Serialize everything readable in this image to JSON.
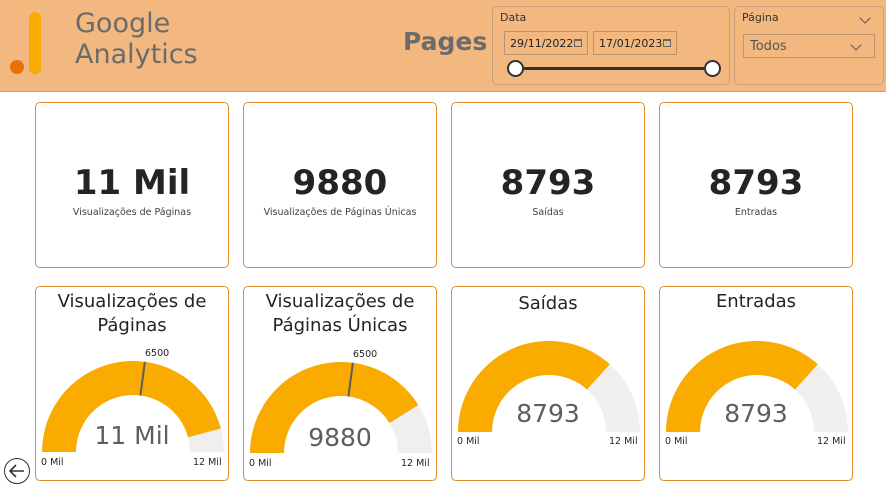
{
  "header": {
    "logo_text_line1": "Google",
    "logo_text_line2": "Analytics",
    "page_title": "Pages"
  },
  "date_slicer": {
    "label": "Data",
    "start": "29/11/2022",
    "end": "17/01/2023"
  },
  "page_slicer": {
    "label": "Página",
    "selected": "Todos"
  },
  "kpis": [
    {
      "value": "11 Mil",
      "label": "Visualizações de Páginas"
    },
    {
      "value": "9880",
      "label": "Visualizações de Páginas Únicas"
    },
    {
      "value": "8793",
      "label": "Saídas"
    },
    {
      "value": "8793",
      "label": "Entradas"
    }
  ],
  "gauges": [
    {
      "title_line1": "Visualizações de",
      "title_line2": "Páginas",
      "value_text": "11 Mil",
      "value": 11000,
      "min": 0,
      "max": 12000,
      "min_label": "0 Mil",
      "max_label": "12 Mil",
      "target": 6500,
      "target_label": "6500"
    },
    {
      "title_line1": "Visualizações de",
      "title_line2": "Páginas Únicas",
      "value_text": "9880",
      "value": 9880,
      "min": 0,
      "max": 12000,
      "min_label": "0 Mil",
      "max_label": "12 Mil",
      "target": 6500,
      "target_label": "6500"
    },
    {
      "title_line1": "Saídas",
      "title_line2": "",
      "value_text": "8793",
      "value": 8793,
      "min": 0,
      "max": 12000,
      "min_label": "0 Mil",
      "max_label": "12 Mil"
    },
    {
      "title_line1": "Entradas",
      "title_line2": "",
      "value_text": "8793",
      "value": 8793,
      "min": 0,
      "max": 12000,
      "min_label": "0 Mil",
      "max_label": "12 Mil"
    }
  ],
  "colors": {
    "header_bg": "#f2b880",
    "card_border": "#e38c2a",
    "gauge_fill": "#f9ab00",
    "gauge_track": "#f0efee"
  }
}
